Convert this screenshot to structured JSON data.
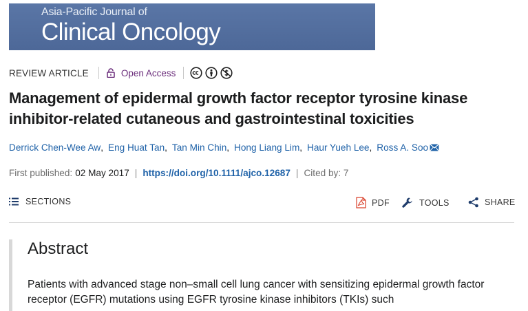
{
  "journal": {
    "name_line1": "Asia-Pacific Journal of",
    "name_line2": "Clinical Oncology"
  },
  "meta": {
    "article_type": "REVIEW ARTICLE",
    "access_label": "Open Access",
    "license_icons": [
      "creative-commons-icon",
      "attribution-icon",
      "non-commercial-icon"
    ]
  },
  "article": {
    "title": "Management of epidermal growth factor receptor tyrosine kinase inhibitor-related cutaneous and gastrointestinal toxicities",
    "authors": [
      "Derrick Chen-Wee Aw",
      "Eng Huat Tan",
      "Tan Min Chin",
      "Hong Liang Lim",
      "Haur Yueh Lee",
      "Ross A. Soo"
    ],
    "first_published_label": "First published:",
    "first_published_date": "02 May 2017",
    "doi": "https://doi.org/10.1111/ajco.12687",
    "cited_by": "Cited by: 7"
  },
  "toolbar": {
    "sections_label": "SECTIONS",
    "pdf_label": "PDF",
    "tools_label": "TOOLS",
    "share_label": "SHARE"
  },
  "abstract": {
    "heading": "Abstract",
    "text": "Patients with advanced stage non–small cell lung cancer with sensitizing epidermal growth factor receptor (EGFR) mutations using EGFR tyrosine kinase inhibitors (TKIs) such"
  },
  "colors": {
    "banner": "#4e6a9a",
    "link": "#1f62a8",
    "open_access": "#6b2d7b",
    "pdf_icon": "#d9402b"
  }
}
